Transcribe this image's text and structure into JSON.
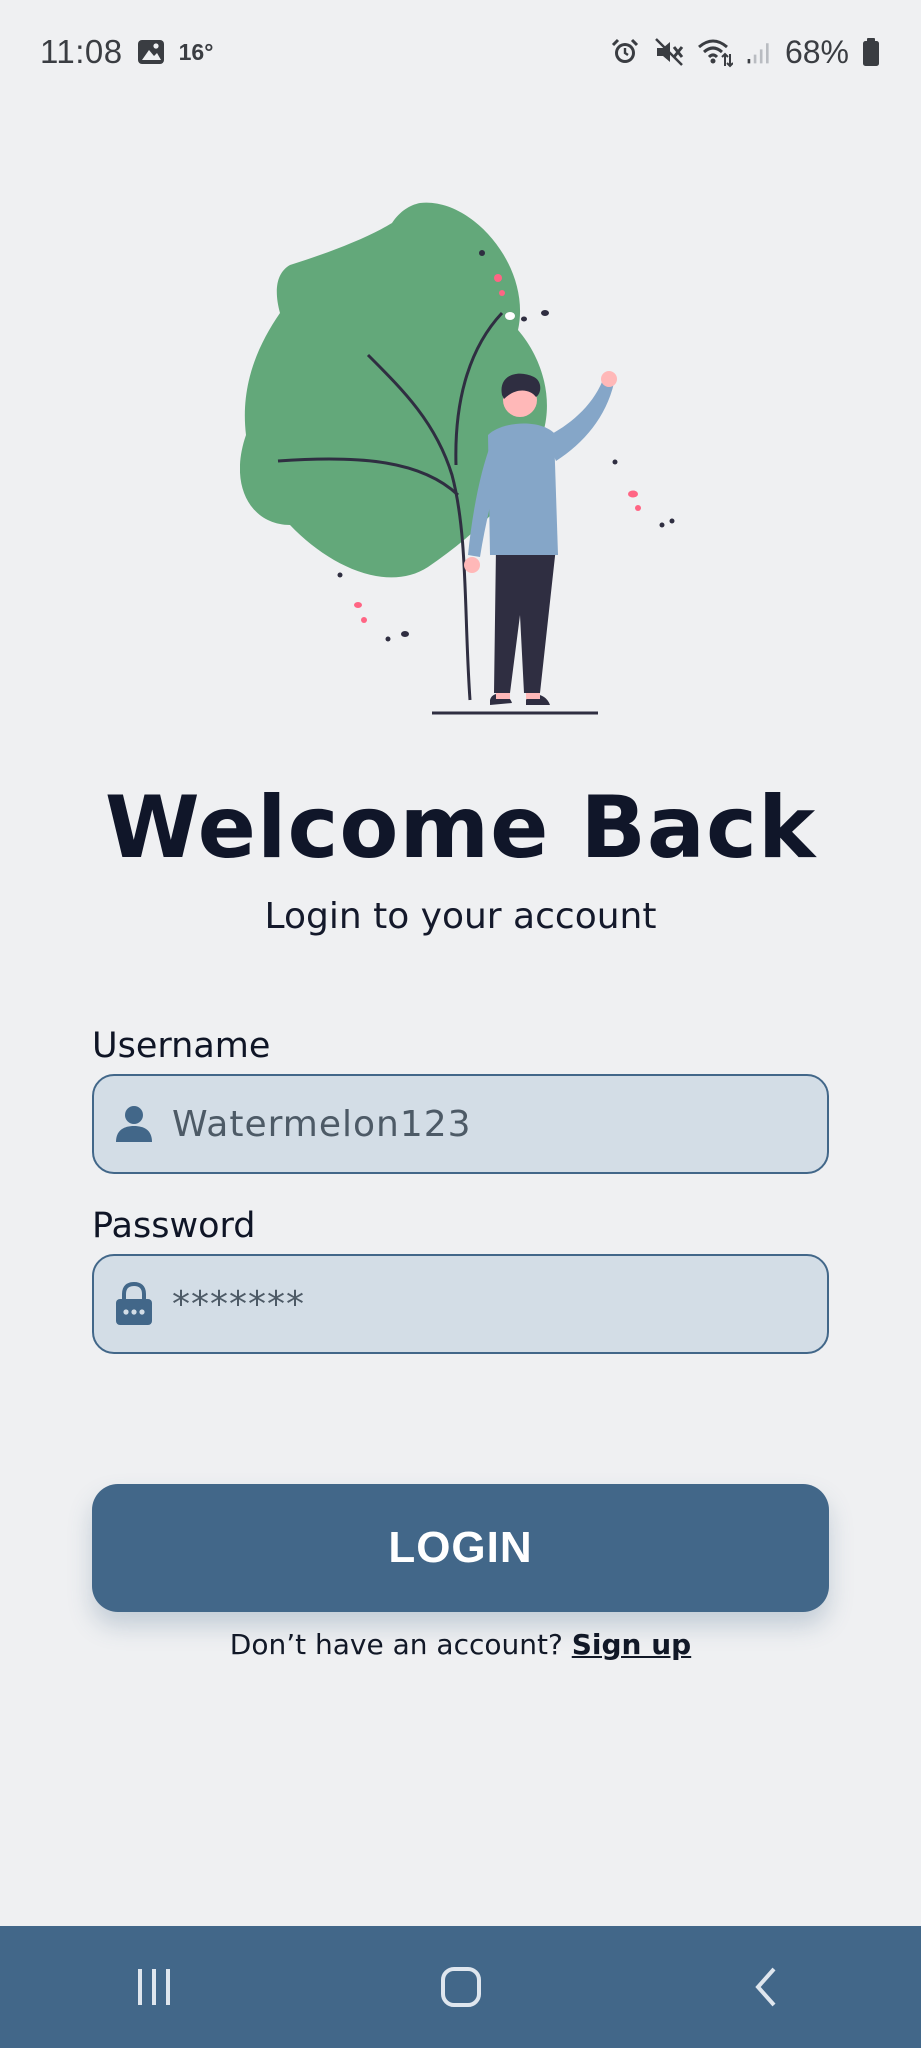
{
  "status_bar": {
    "time": "11:08",
    "temperature": "16°",
    "battery": "68%",
    "icons": [
      "gallery-icon",
      "alarm-icon",
      "mute-icon",
      "wifi-icon",
      "signal-icon",
      "battery-icon"
    ]
  },
  "header": {
    "title": "Welcome Back",
    "subtitle": "Login to your account"
  },
  "form": {
    "username": {
      "label": "Username",
      "value": "Watermelon123",
      "icon": "user-icon"
    },
    "password": {
      "label": "Password",
      "value": "*******",
      "icon": "lock-icon"
    }
  },
  "login_button": {
    "label": "LOGIN"
  },
  "signup": {
    "prompt": "Don’t have an account? ",
    "link": "Sign up"
  },
  "nav": {
    "icons": [
      "recent-apps-icon",
      "home-icon",
      "back-icon"
    ]
  },
  "colors": {
    "background": "#eff0f2",
    "accent": "#426789",
    "field_fill": "#d3dde6",
    "leaf_green": "#63a87a"
  }
}
